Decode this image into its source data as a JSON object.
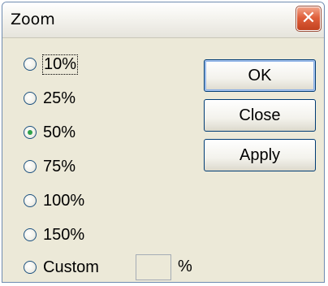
{
  "window": {
    "title": "Zoom",
    "close_glyph": "✕"
  },
  "zoom_options": [
    {
      "label": "10%",
      "checked": false,
      "focused": true
    },
    {
      "label": "25%",
      "checked": false,
      "focused": false
    },
    {
      "label": "50%",
      "checked": true,
      "focused": false
    },
    {
      "label": "75%",
      "checked": false,
      "focused": false
    },
    {
      "label": "100%",
      "checked": false,
      "focused": false
    },
    {
      "label": "150%",
      "checked": false,
      "focused": false
    },
    {
      "label": "Custom",
      "checked": false,
      "focused": false
    }
  ],
  "custom": {
    "value": "",
    "unit": "%"
  },
  "buttons": {
    "ok": "OK",
    "close": "Close",
    "apply": "Apply"
  },
  "colors": {
    "close_button": "#d8512c",
    "selected_radio": "#2ea14a",
    "default_button_border": "#003c74"
  }
}
